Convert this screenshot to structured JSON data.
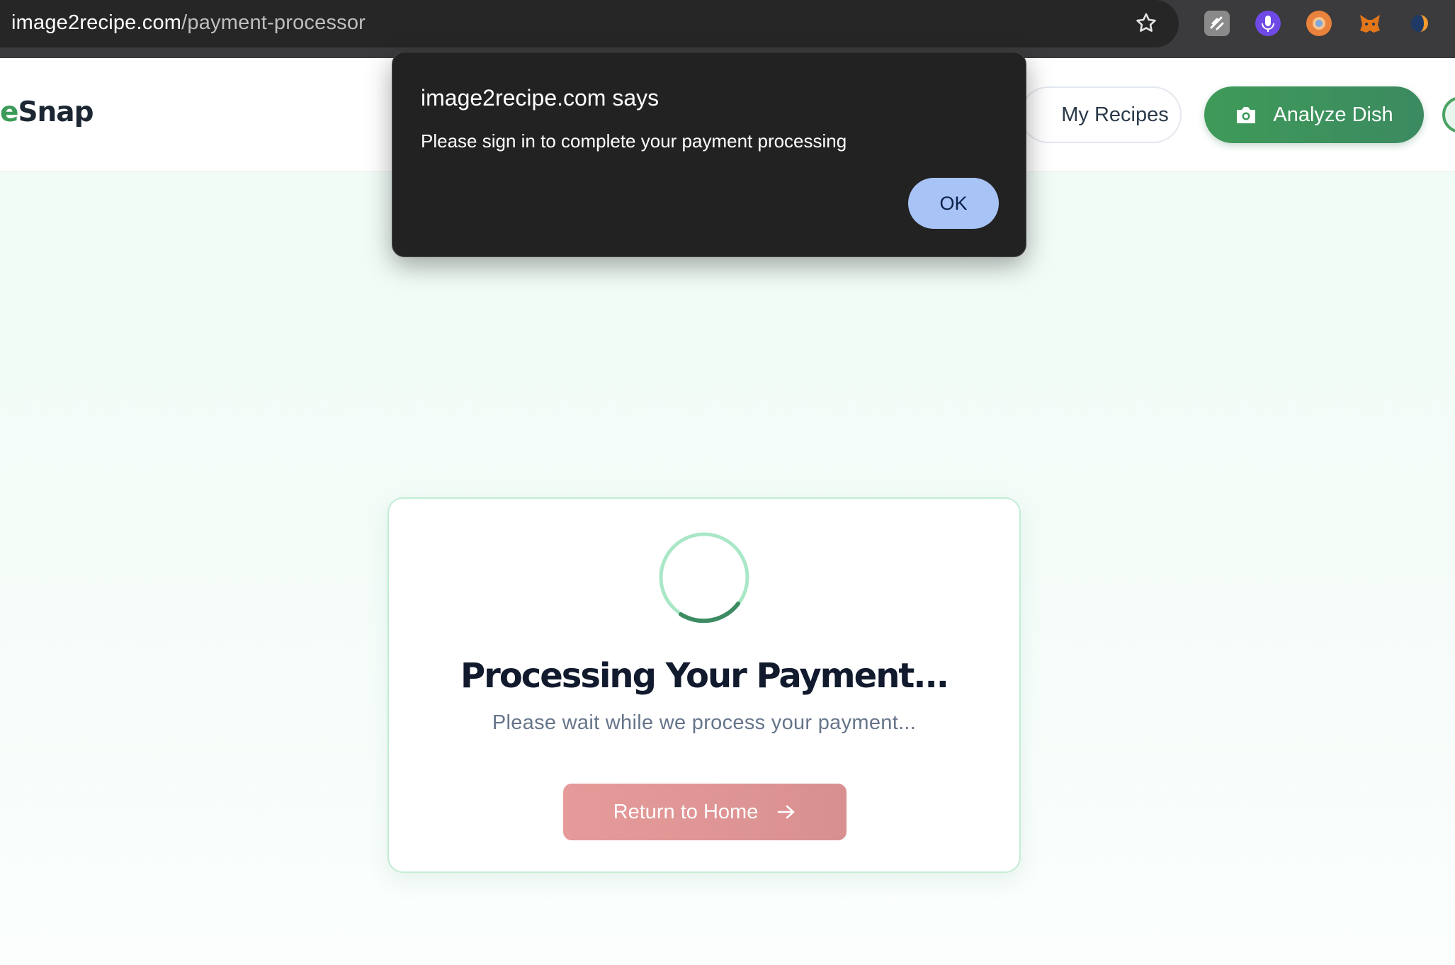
{
  "browser": {
    "url_host": "image2recipe.com",
    "url_path": "/payment-processor",
    "icons": [
      "star-icon",
      "extension-icon",
      "microphone-icon",
      "browser-extension-icon",
      "metamask-fox-icon",
      "extension-icon"
    ]
  },
  "header": {
    "logo_accent": "e",
    "logo_main": "Snap",
    "my_recipes_label": "My Recipes",
    "analyze_label": "Analyze Dish",
    "analyze_icon": "camera-icon"
  },
  "card": {
    "title": "Processing Your Payment...",
    "subtitle": "Please wait while we process your payment...",
    "return_label": "Return to Home",
    "return_icon": "arrow-right-icon",
    "spinner_icon": "loading-spinner-icon"
  },
  "dialog": {
    "title": "image2recipe.com says",
    "message": "Please sign in to complete your payment processing",
    "ok_label": "OK"
  },
  "colors": {
    "brand_green": "#3f9a59",
    "return_button": "#e59b9a",
    "dialog_bg": "#222222",
    "ok_button": "#a8c3f5",
    "page_bg": "#effcf5"
  }
}
